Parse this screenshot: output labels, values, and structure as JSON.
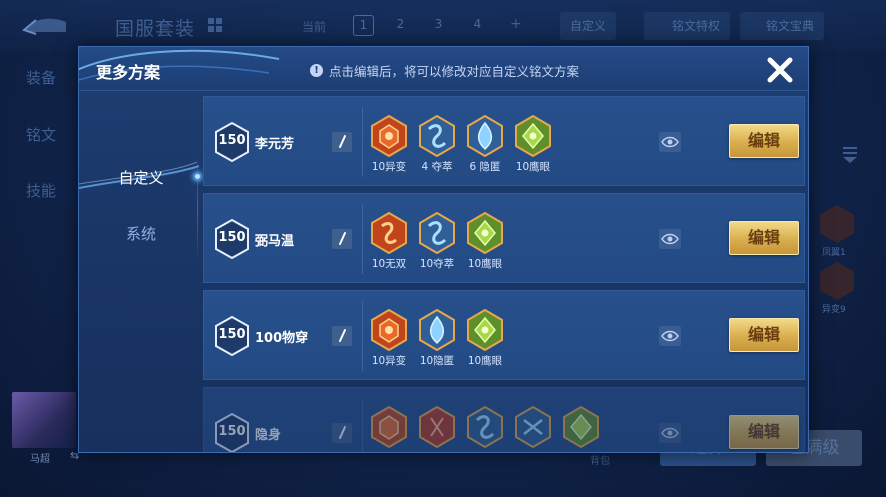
{
  "background": {
    "title": "国服套装",
    "current_label": "当前",
    "pages": [
      "1",
      "2",
      "3",
      "4"
    ],
    "selected_page": "1",
    "add_label": "+",
    "custom_label": "自定义",
    "privilege_label": "铭文特权",
    "treasure_label": "铭文宝典",
    "side_tabs": [
      "装备",
      "铭文",
      "技能"
    ],
    "right_runes": [
      "凤翼1",
      "异变9"
    ],
    "hero_name": "马超",
    "select_label": "选择",
    "maxed_label": "已满级",
    "bag_label": "背包"
  },
  "modal": {
    "title": "更多方案",
    "hint_icon": "!",
    "hint": "点击编辑后，将可以修改对应自定义铭文方案",
    "tabs": [
      {
        "label": "自定义",
        "active": true
      },
      {
        "label": "系统",
        "active": false
      }
    ],
    "schemes": [
      {
        "level": "150",
        "name": "李元芳",
        "edit_label": "编辑",
        "runes": [
          {
            "label": "10异变",
            "color": "red"
          },
          {
            "label": "4 夺萃",
            "color": "blue"
          },
          {
            "label": "6 隐匿",
            "color": "blue"
          },
          {
            "label": "10鹰眼",
            "color": "green"
          }
        ]
      },
      {
        "level": "150",
        "name": "弼马温",
        "edit_label": "编辑",
        "runes": [
          {
            "label": "10无双",
            "color": "red"
          },
          {
            "label": "10夺萃",
            "color": "blue"
          },
          {
            "label": "10鹰眼",
            "color": "green"
          }
        ]
      },
      {
        "level": "150",
        "name": "100物穿",
        "edit_label": "编辑",
        "runes": [
          {
            "label": "10异变",
            "color": "red"
          },
          {
            "label": "10隐匿",
            "color": "blue"
          },
          {
            "label": "10鹰眼",
            "color": "green"
          }
        ]
      },
      {
        "level": "150",
        "name": "隐身",
        "edit_label": "编辑",
        "runes": [
          {
            "label": "",
            "color": "red"
          },
          {
            "label": "",
            "color": "red"
          },
          {
            "label": "",
            "color": "blue"
          },
          {
            "label": "",
            "color": "blue"
          },
          {
            "label": "",
            "color": "green"
          }
        ]
      }
    ]
  },
  "colors": {
    "edit_gold": "#d9ae4d",
    "panel_blue": "#1a3768",
    "row_blue": "#27508c",
    "rune_red": "#c0451c",
    "rune_blue": "#5aa9d8",
    "rune_green": "#8fbf3a"
  },
  "icons": {
    "close": "close-icon",
    "eye": "eye-icon",
    "rename": "pencil-icon",
    "back": "back-arrow-icon",
    "info": "info-icon"
  }
}
